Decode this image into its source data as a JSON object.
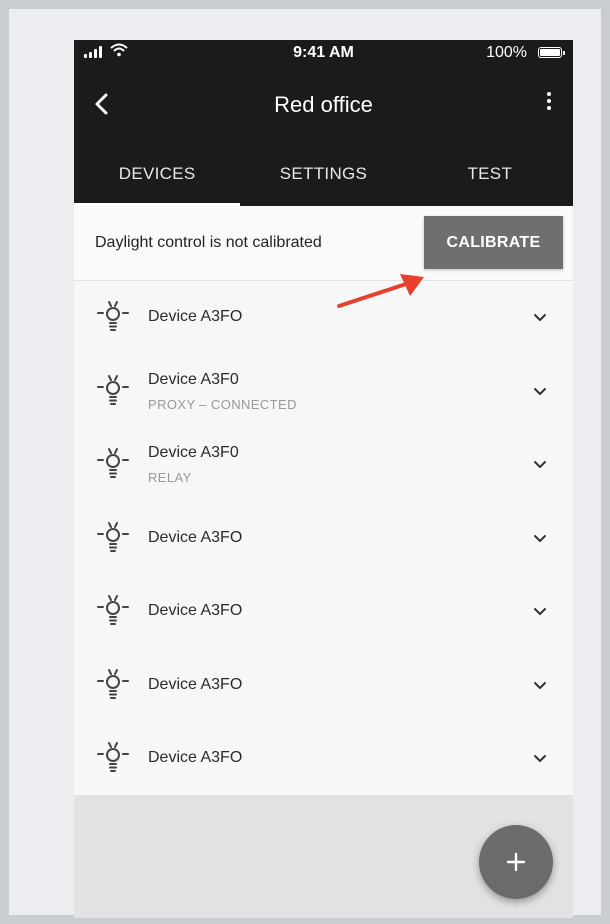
{
  "status_bar": {
    "time": "9:41 AM",
    "battery": "100%"
  },
  "header": {
    "title": "Red office",
    "back_icon": "back-chevron-icon",
    "menu_icon": "more-vertical-icon"
  },
  "tabs": [
    {
      "label": "DEVICES",
      "active": true
    },
    {
      "label": "SETTINGS",
      "active": false
    },
    {
      "label": "TEST",
      "active": false
    }
  ],
  "banner": {
    "message": "Daylight control is not calibrated",
    "button_label": "CALIBRATE",
    "annotation_color": "#e8402f"
  },
  "devices": [
    {
      "name": "Device A3FO",
      "subtitle": ""
    },
    {
      "name": "Device A3F0",
      "subtitle": "PROXY – CONNECTED"
    },
    {
      "name": "Device A3F0",
      "subtitle": "RELAY"
    },
    {
      "name": "Device A3FO",
      "subtitle": ""
    },
    {
      "name": "Device A3FO",
      "subtitle": ""
    },
    {
      "name": "Device A3FO",
      "subtitle": ""
    },
    {
      "name": "Device A3FO",
      "subtitle": ""
    }
  ],
  "fab": {
    "icon": "plus-icon"
  },
  "colors": {
    "header_bg": "#1b1b1b",
    "button_bg": "#6f6f6f",
    "fab_bg": "#6b6b6b"
  }
}
